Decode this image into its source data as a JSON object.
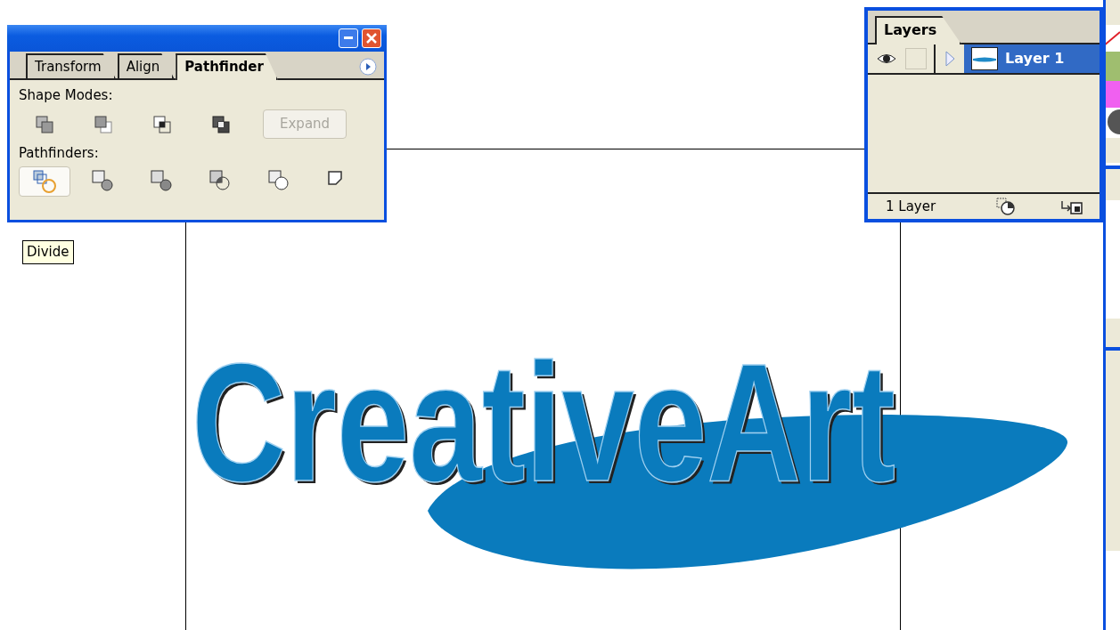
{
  "pathfinder_panel": {
    "tabs": [
      {
        "label": "Transform",
        "selected": false
      },
      {
        "label": "Align",
        "selected": false
      },
      {
        "label": "Pathfinder",
        "selected": true
      }
    ],
    "shape_modes_label": "Shape Modes:",
    "expand_button": {
      "label": "Expand",
      "disabled": true
    },
    "pathfinders_label": "Pathfinders:",
    "pathfinder_buttons": [
      {
        "selected": true
      },
      {
        "selected": false
      },
      {
        "selected": false
      },
      {
        "selected": false
      },
      {
        "selected": false
      },
      {
        "selected": false
      }
    ]
  },
  "tooltip": "Divide",
  "layers_panel": {
    "tabs": [
      {
        "label": "Layers",
        "selected": true
      }
    ],
    "layers": [
      {
        "name": "Layer 1",
        "visible": true,
        "locked": false,
        "expanded": false,
        "selected": true
      }
    ],
    "footer": "1 Layer"
  },
  "artwork": {
    "text": "CreativeArt"
  }
}
